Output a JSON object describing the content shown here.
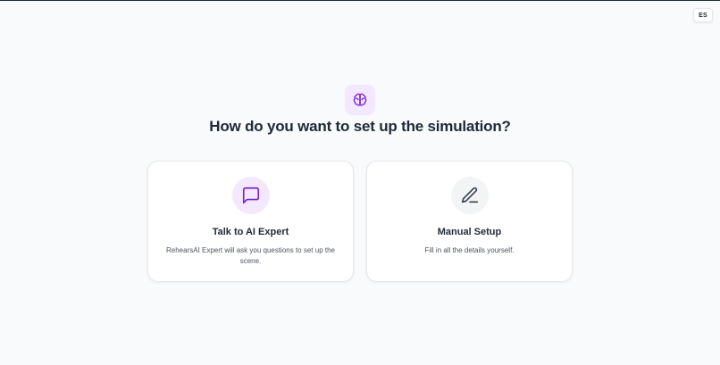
{
  "header": {
    "language_label": "ES"
  },
  "hero": {
    "icon": "brain-icon",
    "title": "How do you want to set up the simulation?"
  },
  "options": [
    {
      "icon": "chat-bubble-icon",
      "title": "Talk to AI Expert",
      "description": "RehearsAI Expert will ask you questions to set up the scene."
    },
    {
      "icon": "pencil-icon",
      "title": "Manual Setup",
      "description": "Fill in all the details yourself."
    }
  ],
  "colors": {
    "accent": "#7e22ce",
    "accent_soft": "#f3e8ff",
    "text_dark": "#1f2937",
    "text_muted": "#4b5563",
    "background": "#f8fafc"
  }
}
